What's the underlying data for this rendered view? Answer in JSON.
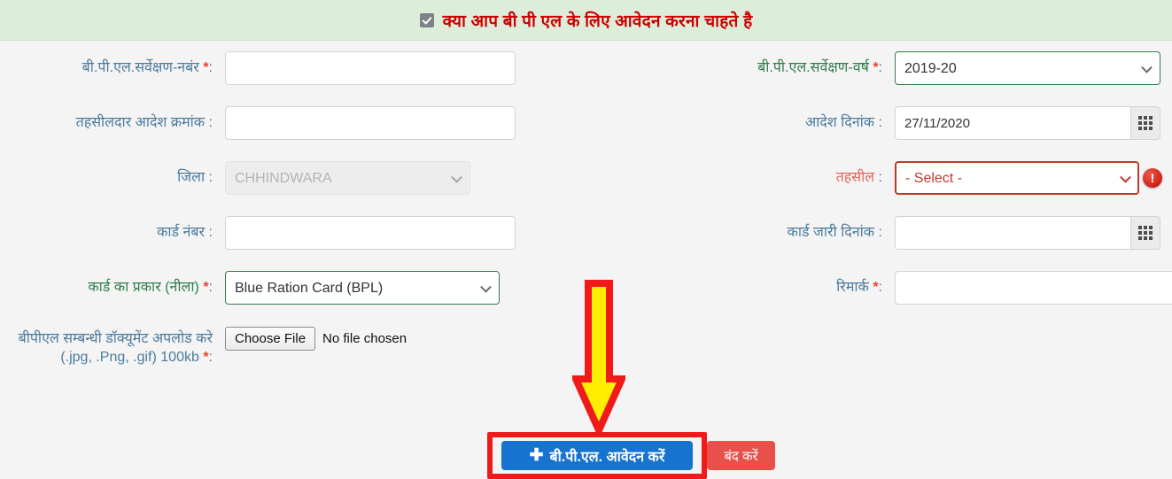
{
  "header": {
    "checkbox_checked": true,
    "checkbox_name": "bpl-apply-checkbox",
    "title": "क्या आप बी पी एल के लिए आवेदन करना चाहते है",
    "bg_color": "#dcedda",
    "text_color": "#cc0000"
  },
  "fields": {
    "survey_number": {
      "label": "बी.पी.एल.सर्वेक्षण-नबंर",
      "required": true,
      "value": "",
      "placeholder": ""
    },
    "survey_year": {
      "label": "बी.पी.एल.सर्वेक्षण-वर्ष",
      "required": true,
      "value": "2019-20",
      "label_color": "#2f7d4d",
      "border_color": "#2f7d4d"
    },
    "tehsildar_order_number": {
      "label": "तहसीलदार आदेश क्रमांक",
      "required": false,
      "value": "",
      "placeholder": ""
    },
    "order_date": {
      "label": "आदेश दिनांक",
      "required": false,
      "value": "27/11/2020",
      "calendar_icon": "calendar-grid-icon"
    },
    "district": {
      "label": "जिला",
      "required": false,
      "value": "CHHINDWARA",
      "disabled": true
    },
    "tehsil": {
      "label": "तहसील",
      "required": false,
      "value": "- Select -",
      "label_color": "#e0685f",
      "border_color": "#c0392b",
      "error": true,
      "error_icon": "error-exclamation-icon"
    },
    "card_number": {
      "label": "कार्ड नंबर",
      "required": false,
      "value": "",
      "placeholder": ""
    },
    "card_issue_date": {
      "label": "कार्ड जारी दिनांक",
      "required": false,
      "value": "",
      "calendar_icon": "calendar-grid-icon"
    },
    "card_type": {
      "label": "कार्ड का प्रकार (नीला)",
      "required": true,
      "value": "Blue Ration Card (BPL)",
      "label_color": "#2f7d4d",
      "border_color": "#2f7d4d"
    },
    "remark": {
      "label": "रिमार्क",
      "required": true,
      "value": "",
      "placeholder": ""
    },
    "document_upload": {
      "label": "बीपीएल सम्बन्धी डॉक्यूमेंट अपलोड करे (.jpg, .Png, .gif) 100kb",
      "required": true,
      "button_label": "Choose File",
      "file_status": "No file chosen"
    }
  },
  "footer": {
    "submit_label": "बी.पी.एल. आवेदन करें",
    "submit_icon": "plus-icon",
    "submit_color": "#1673cf",
    "close_label": "बंद करें",
    "close_color": "#e8514a"
  },
  "annotations": {
    "arrow": {
      "name": "down-arrow-annotation",
      "fill": "#ffee00",
      "stroke": "#f01a1a"
    },
    "box": {
      "name": "highlight-box-annotation",
      "stroke": "#f01a1a"
    }
  },
  "symbols": {
    "asterisk": "*",
    "colon": ":"
  }
}
